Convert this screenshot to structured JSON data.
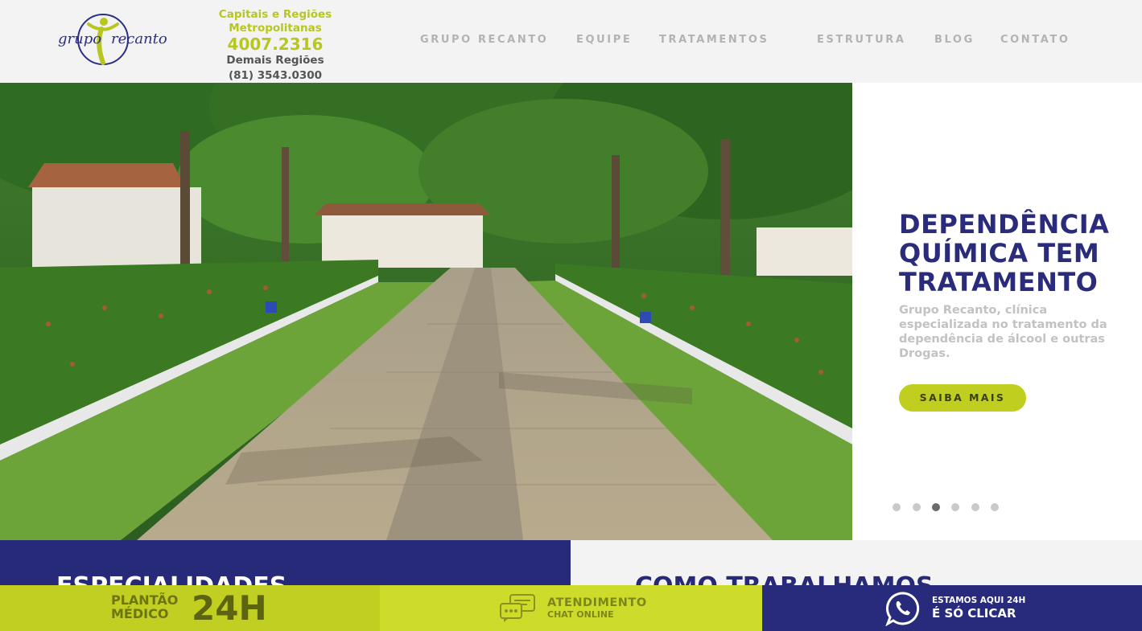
{
  "header": {
    "logo": {
      "text_left": "grupo",
      "text_right": "recanto"
    },
    "contact": {
      "line1": "Capitais e Regiões Metropolitanas",
      "phone_main": "4007.2316",
      "line3": "Demais Regiões",
      "phone_other": "(81) 3543.0300"
    },
    "nav": [
      "GRUPO RECANTO",
      "EQUIPE",
      "TRATAMENTOS",
      "ESTRUTURA",
      "BLOG",
      "CONTATO"
    ]
  },
  "hero": {
    "title": "DEPENDÊNCIA QUÍMICA TEM TRATAMENTO",
    "subtitle": "Grupo Recanto, clínica especializada no tratamento da dependência de álcool e outras Drogas.",
    "button": "SAIBA MAIS",
    "slide_count": 6,
    "active_slide": 3
  },
  "sections": {
    "left_title": "ESPECIALIDADES",
    "right_title": "COMO TRABALHAMOS"
  },
  "footer_bar": {
    "plantao_line1": "PLANTÃO",
    "plantao_line2": "MÉDICO",
    "plantao_big": "24H",
    "atendimento_line1": "ATENDIMENTO",
    "atendimento_line2": "CHAT ONLINE",
    "whatsapp_line1": "ESTAMOS AQUI 24H",
    "whatsapp_line2": "É SÓ CLICAR"
  },
  "colors": {
    "navy": "#272a79",
    "lime": "#c1ce22",
    "grey_nav": "#b3b3b3"
  }
}
